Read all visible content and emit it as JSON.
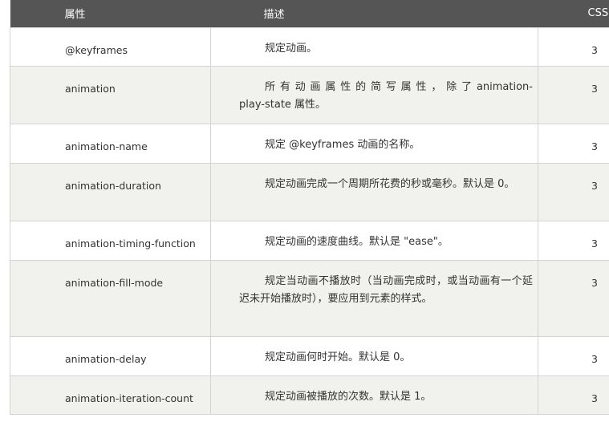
{
  "table": {
    "headers": [
      "属性",
      "描述",
      "CSS"
    ],
    "rows": [
      {
        "property": "@keyframes",
        "description": "规定动画。",
        "css": "3"
      },
      {
        "property": "animation",
        "description": "所 有 动 画 属 性 的 简 写 属 性 ， 除 了 animation-play-state 属性。",
        "css": "3"
      },
      {
        "property": "animation-name",
        "description": "规定 @keyframes 动画的名称。",
        "css": "3"
      },
      {
        "property": "animation-duration",
        "description": "规定动画完成一个周期所花费的秒或毫秒。默认是 0。",
        "css": "3"
      },
      {
        "property": "animation-timing-function",
        "description": "规定动画的速度曲线。默认是 \"ease\"。",
        "css": "3"
      },
      {
        "property": "animation-fill-mode",
        "description": "规定当动画不播放时（当动画完成时，或当动画有一个延迟未开始播放时），要应用到元素的样式。",
        "css": "3"
      },
      {
        "property": "animation-delay",
        "description": "规定动画何时开始。默认是 0。",
        "css": "3"
      },
      {
        "property": "animation-iteration-count",
        "description": "规定动画被播放的次数。默认是 1。",
        "css": "3"
      }
    ]
  }
}
